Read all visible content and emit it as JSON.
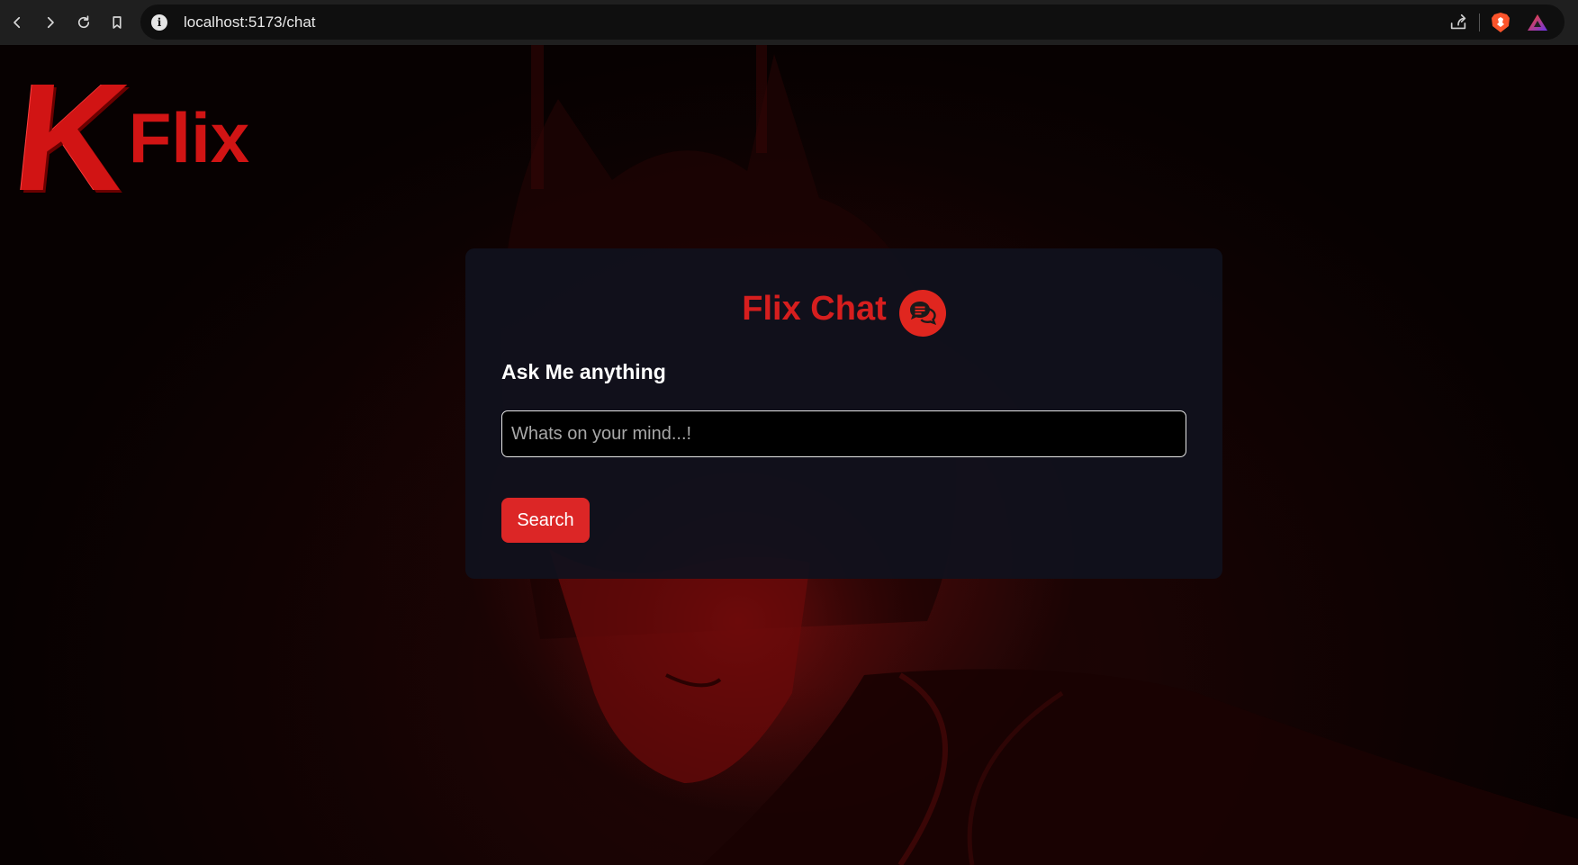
{
  "browser": {
    "url": "localhost:5173/chat",
    "icons": [
      "back-icon",
      "forward-icon",
      "reload-icon",
      "bookmark-icon",
      "site-info-icon",
      "share-icon",
      "brave-shields-icon",
      "brave-rewards-icon"
    ]
  },
  "logo": {
    "k": "K",
    "flix": "Flix",
    "color": "#d11414"
  },
  "chat": {
    "title": "Flix Chat",
    "subtitle": "Ask Me anything",
    "input_placeholder": "Whats on your mind...!",
    "input_value": "",
    "search_label": "Search",
    "accent": "#dc2626",
    "card_bg": "#10111d"
  }
}
